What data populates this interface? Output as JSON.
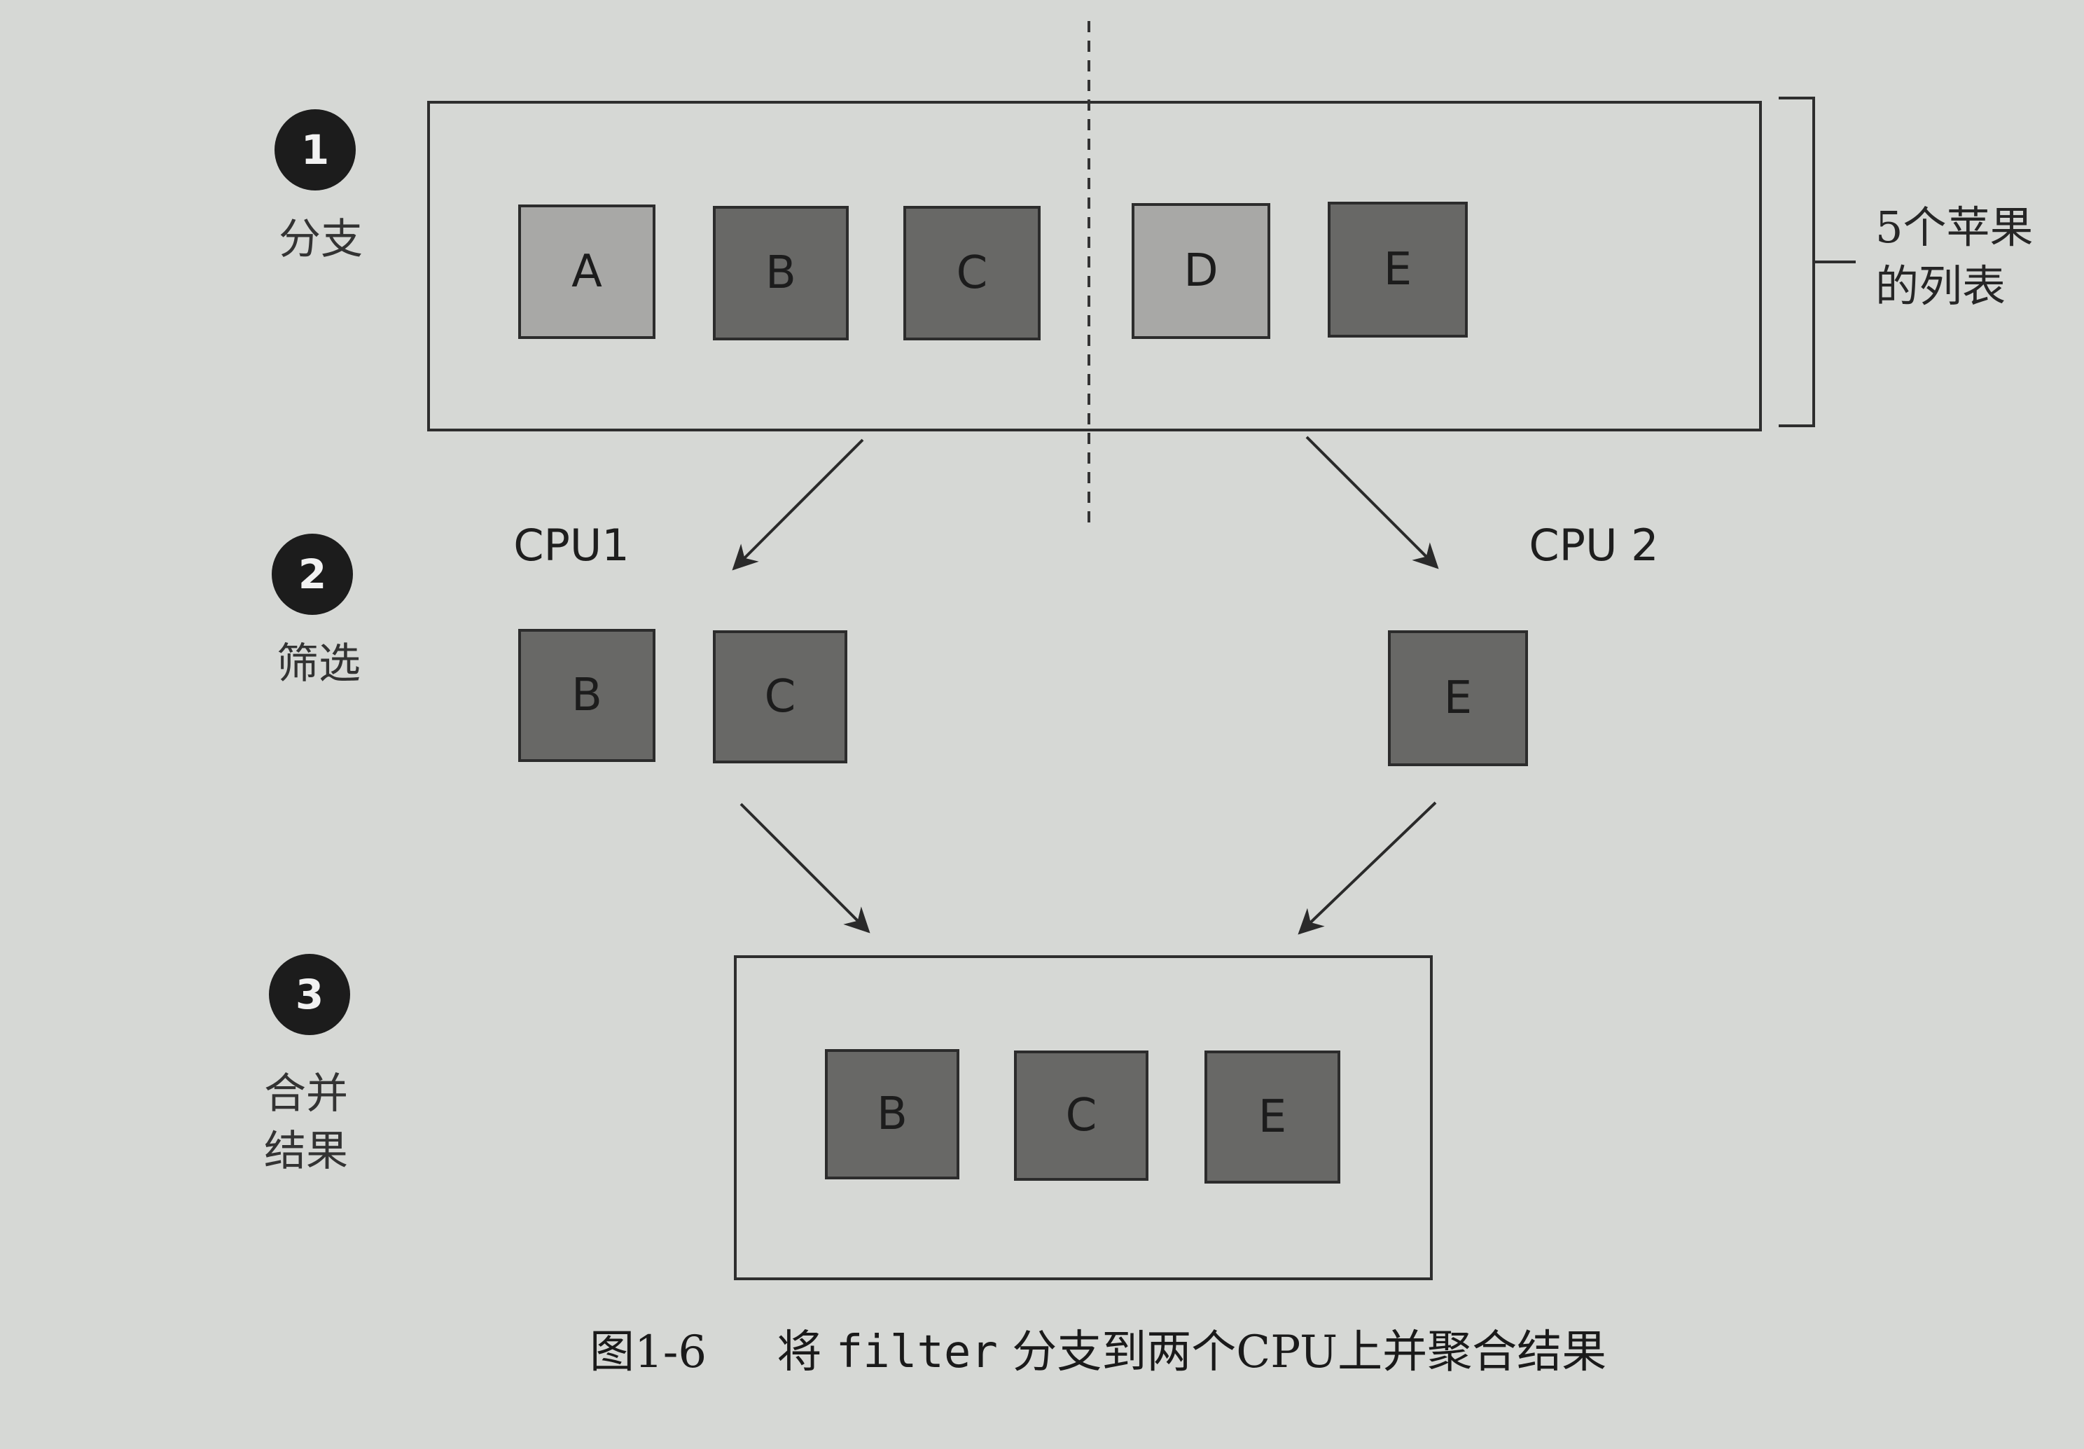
{
  "steps": [
    {
      "number": "1",
      "label": "分支"
    },
    {
      "number": "2",
      "label": "筛选"
    },
    {
      "number": "3",
      "label_line1": "合并",
      "label_line2": "结果"
    }
  ],
  "list": {
    "items": [
      {
        "letter": "A",
        "shade": "light"
      },
      {
        "letter": "B",
        "shade": "dark"
      },
      {
        "letter": "C",
        "shade": "dark"
      },
      {
        "letter": "D",
        "shade": "light"
      },
      {
        "letter": "E",
        "shade": "dark"
      }
    ],
    "note_line1": "5个苹果",
    "note_line2": "的列表"
  },
  "cpus": [
    {
      "label": "CPU1",
      "items": [
        "B",
        "C"
      ]
    },
    {
      "label": "CPU 2",
      "items": [
        "E"
      ]
    }
  ],
  "result": {
    "items": [
      "B",
      "C",
      "E"
    ]
  },
  "caption": {
    "figure_number": "图1-6",
    "text_before": "将",
    "code": "filter",
    "text_after": "分支到两个CPU上并聚合结果"
  },
  "colors": {
    "light_box": "#a8a8a6",
    "dark_box": "#686866"
  }
}
